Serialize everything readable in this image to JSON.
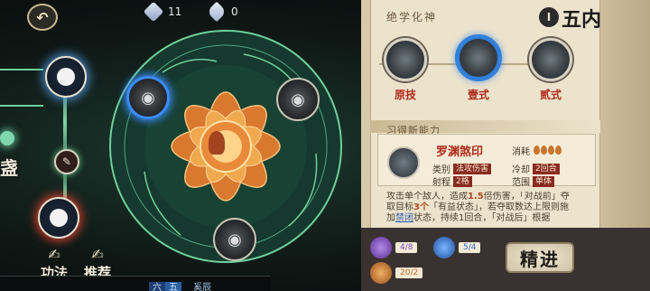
{
  "topbar": {
    "back_label": "↶",
    "resource1": {
      "icon": "jade-icon",
      "value": "11"
    },
    "resource2": {
      "icon": "scroll-icon",
      "value": "0"
    }
  },
  "left_tree": {
    "nodes": [
      {
        "icon": "meditation-figure-icon",
        "glow": "#5aaaff"
      },
      {
        "icon": "scroll-rune-icon",
        "glow": "#78dc96"
      },
      {
        "icon": "meditation-figure-icon",
        "glow": "#ff4632"
      }
    ],
    "partial_text": "盏"
  },
  "buttons": {
    "skill_label": "功法",
    "recommend_label": "推荐"
  },
  "ring": {
    "center_icon": "lotus-figure-icon",
    "slots": 3
  },
  "bottom_bar": {
    "tag1": "六",
    "tag2": "五",
    "label": "奚辰"
  },
  "panel": {
    "section_title": "绝学化神",
    "realm_label": "五内",
    "realm_icon": "I",
    "tiers": [
      {
        "label": "原技",
        "selected": false
      },
      {
        "label": "壹式",
        "selected": true
      },
      {
        "label": "贰式",
        "selected": false
      }
    ],
    "learned_title": "习得新能力",
    "skill": {
      "name": "罗渊煞印",
      "cost_label": "消耗",
      "cost_drops": 4,
      "stats": [
        {
          "label": "类别",
          "value": "法攻伤害"
        },
        {
          "label": "冷却",
          "value": "2回合"
        },
        {
          "label": "射程",
          "value": "2格"
        },
        {
          "label": "范围",
          "value": "单体"
        }
      ]
    },
    "description": {
      "l1a": "攻击单个敌人，造成",
      "l1b": "1.5",
      "l1c": "倍伤害，「对战前」夺",
      "l2a": "取目标",
      "l2b": "3个",
      "l2c": "「有益状态」，若夺取数达上限则施",
      "l3a": "加",
      "l3b": "禁闭",
      "l3c": "状态，持续1回合，「对战后」根据"
    },
    "footer": {
      "items": [
        {
          "icon": "purple-orb-icon",
          "value": "4/8",
          "color": "#7a4dbd"
        },
        {
          "icon": "blue-sword-icon",
          "value": "5/4",
          "color": "#2f6fd0"
        },
        {
          "icon": "orange-coin-icon",
          "value": "20/2",
          "color": "#c46a24"
        }
      ],
      "confirm_label": "精进"
    }
  }
}
